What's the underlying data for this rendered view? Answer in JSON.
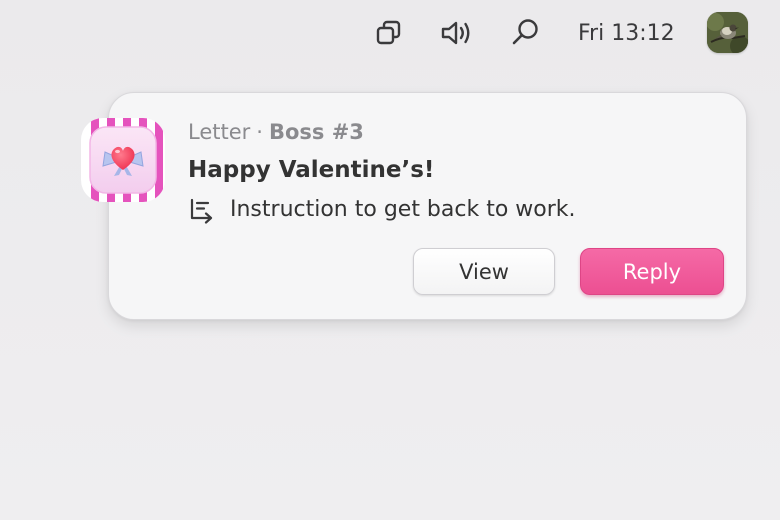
{
  "menubar": {
    "icons": [
      "windows-icon",
      "volume-icon",
      "search-icon",
      "avatar"
    ],
    "clock": "Fri 13:12"
  },
  "notification": {
    "app_icon": "heart-letter-icon",
    "app_name": "Letter",
    "separator": "·",
    "sender": "Boss #3",
    "title": "Happy Valentine’s!",
    "body": "Instruction to get back to work.",
    "body_icon": "reply-arrow-icon",
    "buttons": {
      "view": "View",
      "reply": "Reply"
    }
  },
  "colors": {
    "accent": "#ec4f92",
    "icon_pink": "#e94fb8",
    "heart": "#f43e5e",
    "bow": "#a7b6e8"
  }
}
